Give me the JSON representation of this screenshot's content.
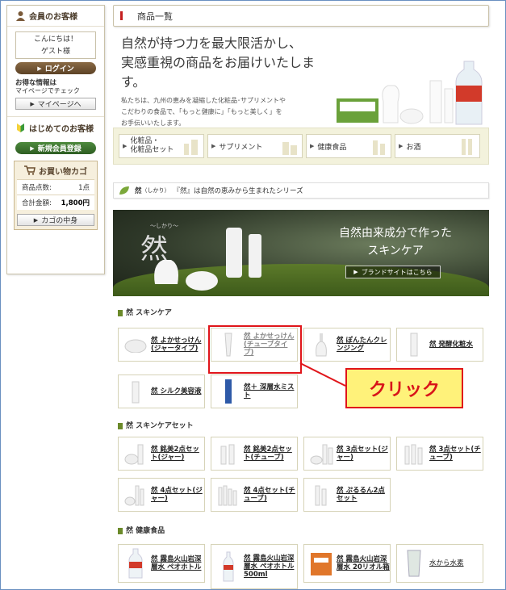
{
  "sidebar": {
    "member_title": "会員のお客様",
    "greeting_line1": "こんにちは！",
    "greeting_line2": "ゲスト様",
    "login_label": "ログイン",
    "info_line1": "お得な情報は",
    "info_line2": "マイページでチェック",
    "mypage_label": "マイページへ",
    "newcomer_title": "はじめてのお客様",
    "register_label": "新規会員登録",
    "cart_title": "お買い物カゴ",
    "cart_count_label": "商品点数:",
    "cart_count_value": "1点",
    "cart_total_label": "合計金額:",
    "cart_total_value": "1,800円",
    "cart_button_label": "カゴの中身"
  },
  "main": {
    "page_title": "商品一覧",
    "hero_line1": "自然が持つ力を最大限活かし、",
    "hero_line2": "実感重視の商品をお届けいたします。",
    "hero_desc1": "私たちは、九州の恵みを凝縮した化粧品･サプリメントや",
    "hero_desc2": "こだわりの食品で、「もっと健康に」「もっと美しく」を",
    "hero_desc3": "お手伝いいたします。",
    "categories": [
      {
        "label1": "化粧品・",
        "label2": "化粧品セット"
      },
      {
        "label1": "サプリメント",
        "label2": ""
      },
      {
        "label1": "健康食品",
        "label2": ""
      },
      {
        "label1": "お酒",
        "label2": ""
      }
    ],
    "series_name": "然",
    "series_reading": "（しかり）",
    "series_desc": "『然』は自然の恵みから生まれたシリーズ",
    "banner_line1": "自然由来成分で作った",
    "banner_line2": "スキンケア",
    "banner_button": "ブランドサイトはこちら",
    "banner_logo_small": "～しかり～"
  },
  "sections": [
    {
      "title": "然 スキンケア",
      "products": [
        {
          "name": "然 よかせっけん(ジャータイプ)"
        },
        {
          "name": "然 よかせっけん(チューブタイプ)"
        },
        {
          "name": "然 ぽんたんクレンジング"
        },
        {
          "name": "然 発酵化粧水"
        },
        {
          "name": "然 シルク美容液"
        },
        {
          "name": "然＋ 深層水ミスト"
        }
      ]
    },
    {
      "title": "然 スキンケアセット",
      "products": [
        {
          "name": "然 銘美2点セット(ジャー)"
        },
        {
          "name": "然 銘美2点セット(チューブ)"
        },
        {
          "name": "然 3点セット(ジャー)"
        },
        {
          "name": "然 3点セット(チューブ)"
        },
        {
          "name": "然 4点セット(ジャー)"
        },
        {
          "name": "然 4点セット(チューブ)"
        },
        {
          "name": "然 ぷるるん2点セット"
        }
      ]
    },
    {
      "title": "然 健康食品",
      "products": [
        {
          "name": "然 霧島火山岩深層水 ペオホトル"
        },
        {
          "name": "然 霧島火山岩深層水 ペオホトル500ml"
        },
        {
          "name": "然 霧島火山岩深層水 20リオル箱"
        },
        {
          "name": "水から水素"
        }
      ]
    }
  ],
  "annotation": {
    "callout": "クリック",
    "color": "#e0151a"
  }
}
